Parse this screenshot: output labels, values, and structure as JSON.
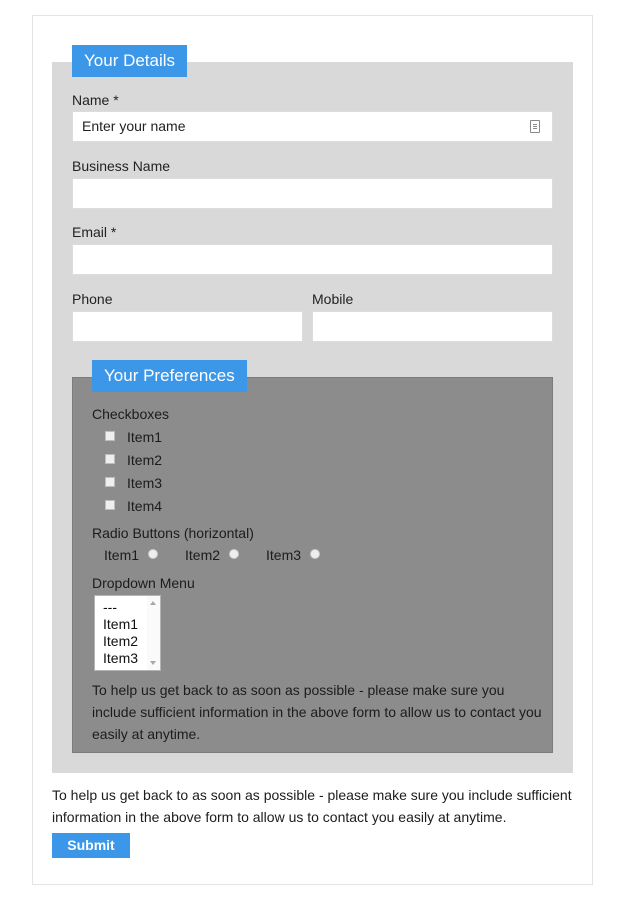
{
  "form": {
    "details_legend": "Your Details",
    "name_label": "Name *",
    "name_placeholder": "Enter your name",
    "business_label": "Business Name",
    "email_label": "Email *",
    "phone_label": "Phone",
    "mobile_label": "Mobile",
    "preferences": {
      "legend": "Your Preferences",
      "checkboxes_label": "Checkboxes",
      "checkboxes": [
        "Item1",
        "Item2",
        "Item3",
        "Item4"
      ],
      "radio_label": "Radio Buttons (horizontal)",
      "radios": [
        "Item1",
        "Item2",
        "Item3"
      ],
      "dropdown_label": "Dropdown Menu",
      "dropdown_options": [
        "---",
        "Item1",
        "Item2",
        "Item3"
      ],
      "help_text": "To help us get back to as soon as possible - please make sure you include sufficient information in the above form to allow us to contact you easily at anytime."
    },
    "help_text": "To help us get back to as soon as possible - please make sure you include sufficient information in the above form to allow us to contact you easily at anytime.",
    "submit_label": "Submit"
  },
  "colors": {
    "accent": "#3c97e8",
    "outer_fieldset": "#d9d9d9",
    "inner_fieldset": "#8c8c8c"
  },
  "icons": {
    "name_field_icon": "contact-card-icon"
  }
}
